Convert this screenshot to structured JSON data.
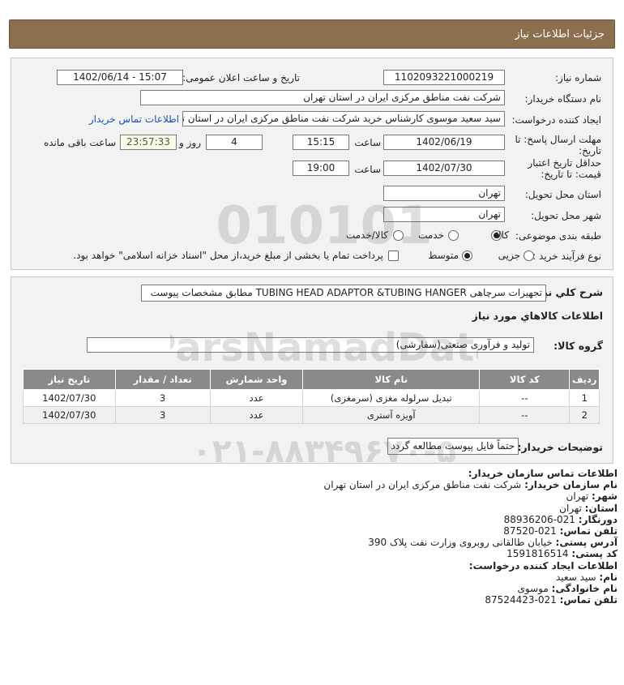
{
  "header": {
    "title": "جزئیات اطلاعات نیاز"
  },
  "form": {
    "need_number_label": "شماره نیاز:",
    "need_number": "1102093221000219",
    "announce_label": "تاریخ و ساعت اعلان عمومی:",
    "announce_value": "1402/06/14 - 15:07",
    "buyer_org_label": "نام دستگاه خریدار:",
    "buyer_org": "شرکت نفت مناطق مرکزی ایران در استان تهران",
    "creator_label": "ایجاد کننده درخواست:",
    "creator": "سید سعید موسوی کارشناس خرید شرکت نفت مناطق مرکزی ایران در استان تهران",
    "contact_link": "اطلاعات تماس خریدار",
    "deadline_label_1": "مهلت ارسال پاسخ: تا",
    "deadline_label_2": "تاریخ:",
    "deadline_date": "1402/06/19",
    "time_label": "ساعت",
    "deadline_time": "15:15",
    "days_value": "4",
    "days_label": "روز و",
    "remaining_time": "23:57:33",
    "remaining_label": "ساعت باقی مانده",
    "validity_label_1": "حداقل تاریخ اعتبار",
    "validity_label_2": "قیمت: تا تاریخ:",
    "validity_date": "1402/07/30",
    "validity_time": "19:00",
    "province_label": "استان محل تحویل:",
    "province": "تهران",
    "city_label": "شهر محل تحویل:",
    "city": "تهران",
    "category_label": "طبقه بندی موضوعی:",
    "category_options": [
      "کالا",
      "خدمت",
      "کالا/خدمت"
    ],
    "process_label": "نوع فرآیند خرید :",
    "process_options": [
      "جزیی",
      "متوسط"
    ],
    "payment_note": "پرداخت تمام یا بخشی از مبلغ خرید،از محل \"اسناد خزانه اسلامی\" خواهد بود."
  },
  "summary": {
    "label": "شرح کلي نیاز:",
    "value": "تجهیزات سرچاهی TUBING HEAD ADAPTOR &TUBING HANGER مطابق مشخصات پیوست"
  },
  "goods": {
    "section_title": "اطلاعات کالاهاي مورد نیاز",
    "group_label": "گروه کالا:",
    "group_value": "تولید و فرآوری صنعتی(سفارشی)",
    "columns": [
      "ردیف",
      "کد کالا",
      "نام کالا",
      "واحد شمارش",
      "تعداد / مقدار",
      "تاریخ نیاز"
    ],
    "rows": [
      [
        "1",
        "--",
        "تبدیل سرلوله مغزی (سرمغزی)",
        "عدد",
        "3",
        "1402/07/30"
      ],
      [
        "2",
        "--",
        "آویزه آستری",
        "عدد",
        "3",
        "1402/07/30"
      ]
    ]
  },
  "buyer_notes": {
    "label": "توضیحات خریدار:",
    "value": "حتماً فایل پیوست مطالعه گردد"
  },
  "contact": {
    "title": "اطلاعات تماس سازمان خریدار:",
    "org_label": "نام سازمان خریدار:",
    "org": "شرکت نفت مناطق مرکزی ایران در استان تهران",
    "city_label": "شهر:",
    "city": "تهران",
    "province_label": "استان:",
    "province": "تهران",
    "fax_label": "دورنگار:",
    "fax": "021-88936206",
    "phone_label": "تلفن تماس:",
    "phone": "021-87520",
    "address_label": "آدرس پستی:",
    "address": "خیابان طالقانی روبروی وزارت نفت پلاک 390",
    "postal_label": "کد پستی:",
    "postal": "1591816514",
    "creator_title": "اطلاعات ایجاد کننده درخواست:",
    "name_label": "نام:",
    "name": "سید سعید",
    "family_label": "نام خانوادگی:",
    "family": "موسوی",
    "creator_phone_label": "تلفن تماس:",
    "creator_phone": "021-87524423"
  },
  "watermark": {
    "brand": "ParsNamadData",
    "phone": "۰۲۱-۸۸۳۴۹۶۷۰-۵"
  },
  "colors": {
    "header_bg": "#8b6f4e",
    "panel_bg": "#f2f2f2",
    "table_header": "#8a8a8a",
    "link": "#1a55b0"
  }
}
